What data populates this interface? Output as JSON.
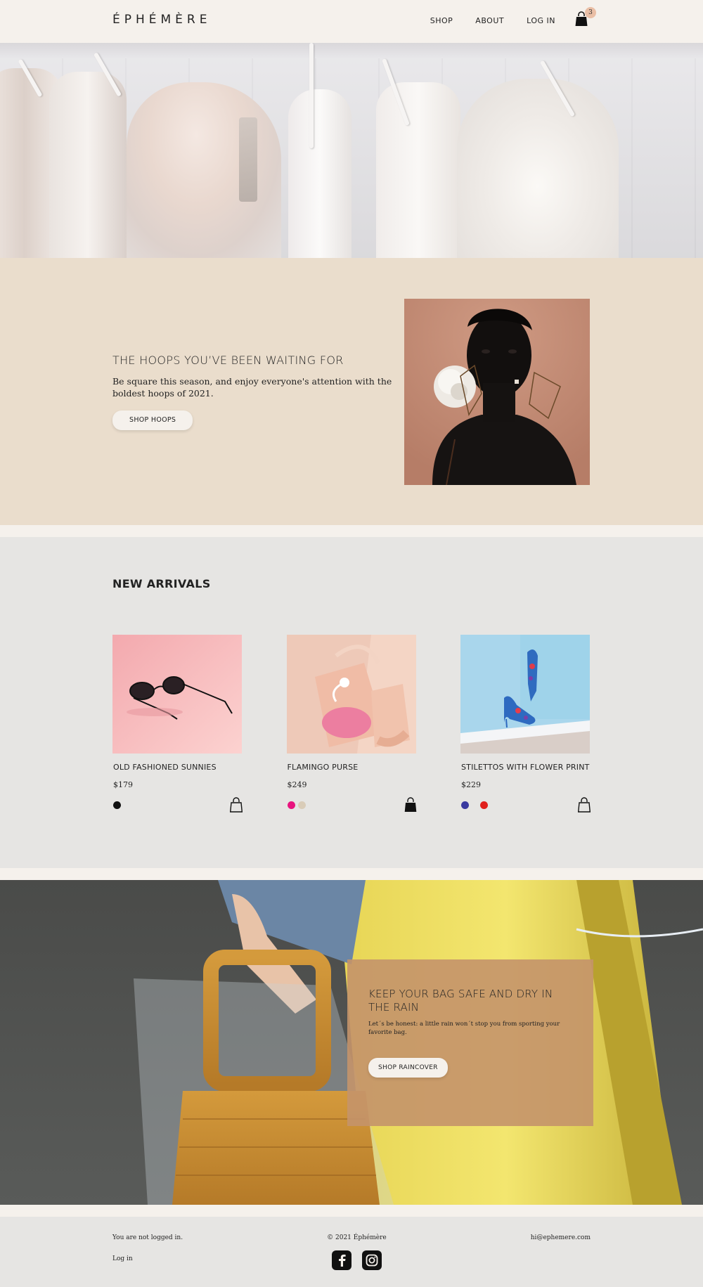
{
  "brand": {
    "logo": "ÉPHÉMÈRE"
  },
  "nav": {
    "items": [
      "SHOP",
      "ABOUT",
      "LOG IN"
    ],
    "cart_count": "3",
    "cart_icon": "shopping-bag-icon"
  },
  "promo": {
    "title": "THE HOOPS YOU’VE BEEN WAITING FOR",
    "body": "Be square this season, and enjoy everyone's attention with the boldest hoops of 2021.",
    "button": "SHOP HOOPS"
  },
  "arrivals": {
    "title": "NEW ARRIVALS",
    "products": [
      {
        "name": "OLD FASHIONED SUNNIES",
        "price": "$179",
        "swatches": [
          "#111111"
        ],
        "bag_filled": false
      },
      {
        "name": "FLAMINGO PURSE",
        "price": "$249",
        "swatches": [
          "#e8157f",
          "#d9ccb8"
        ],
        "bag_filled": true
      },
      {
        "name": "STILETTOS WITH FLOWER PRINT",
        "price": "$229",
        "swatches": [
          "#3a3aa0",
          "#e0201c"
        ],
        "bag_filled": false
      }
    ]
  },
  "rain": {
    "title": "KEEP YOUR BAG SAFE AND DRY IN THE RAIN",
    "body": "Let´s be honest: a little rain won´t stop you from sporting your favorite bag.",
    "button": "SHOP RAINCOVER"
  },
  "footer": {
    "login_status": "You are not logged in.",
    "login_link": "Log in",
    "copyright": "© 2021 Éphémère",
    "email": "hi@ephemere.com",
    "socials": [
      "facebook-icon",
      "instagram-icon"
    ]
  },
  "colors": {
    "cream": "#f5f1ec",
    "sand": "#eaddcc",
    "grey": "#e6e5e3",
    "caramel": "#c4936a"
  }
}
